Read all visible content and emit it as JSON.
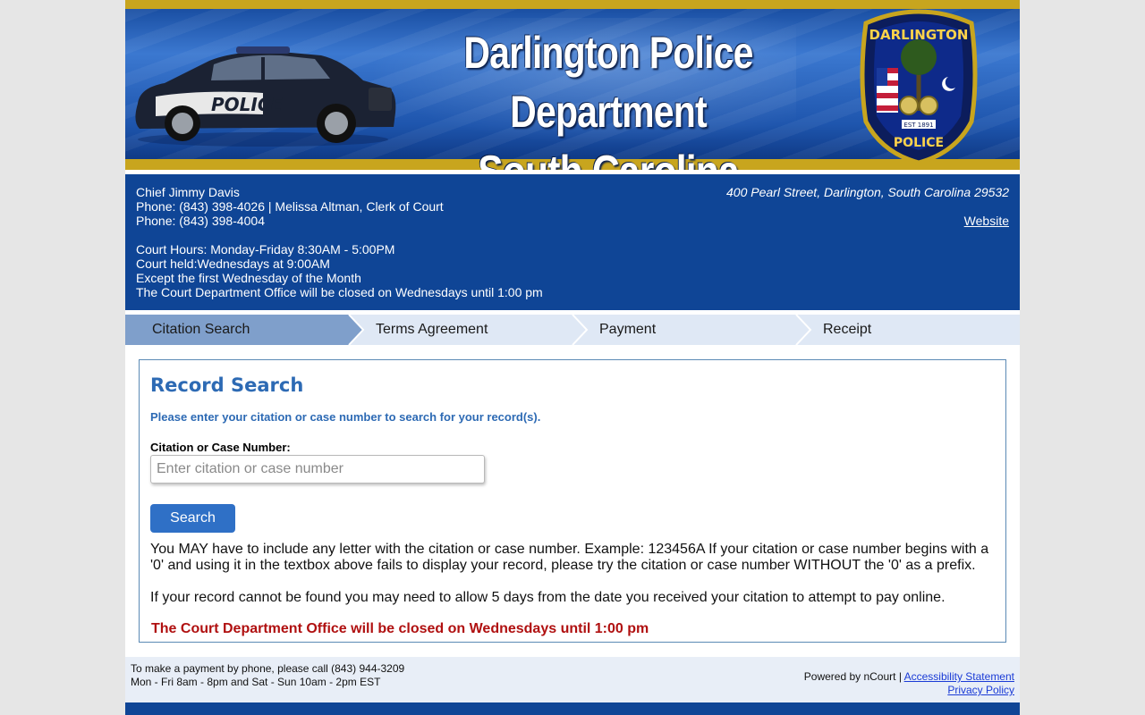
{
  "banner": {
    "title_line1": "Darlington Police Department",
    "title_line2": "South Carolina",
    "car_text": "POLICE",
    "badge_top": "DARLINGTON",
    "badge_bottom": "POLICE",
    "badge_est": "EST 1891"
  },
  "info": {
    "chief": "Chief Jimmy Davis",
    "phone1": "Phone: (843) 398-4026 | Melissa Altman, Clerk of Court",
    "phone2": "Phone: (843) 398-4004",
    "hours": "Court Hours: Monday-Friday 8:30AM - 5:00PM",
    "held": "Court held:Wednesdays at 9:00AM",
    "except": "Except the first Wednesday of the Month",
    "closed": "The Court Department Office will be closed on Wednesdays until 1:00 pm",
    "address": "400 Pearl Street, Darlington, South Carolina 29532",
    "website": "Website"
  },
  "steps": [
    {
      "label": "Citation Search",
      "active": true
    },
    {
      "label": "Terms Agreement",
      "active": false
    },
    {
      "label": "Payment",
      "active": false
    },
    {
      "label": "Receipt",
      "active": false
    }
  ],
  "search": {
    "heading": "Record Search",
    "hint": "Please enter your citation or case number to search for your record(s).",
    "field_label": "Citation or Case Number:",
    "placeholder": "Enter citation or case number",
    "value": "",
    "button": "Search",
    "para1": "You MAY have to include any letter with the citation or case number. Example: 123456A If your citation or case number begins with a '0' and using it in the textbox above fails to display your record, please try the citation or case number WITHOUT the '0' as a prefix.",
    "para2": "If your record cannot be found you may need to allow 5 days from the date you received your citation to attempt to pay online.",
    "notice": "The Court Department Office will be closed on Wednesdays until 1:00 pm"
  },
  "footer": {
    "phone_line": "To make a payment by phone, please call (843) 944-3209",
    "hours_line": "Mon - Fri 8am - 8pm and Sat - Sun 10am - 2pm EST",
    "powered": "Powered by nCourt |",
    "accessibility": "Accessibility Statement",
    "privacy": "Privacy Policy"
  },
  "colors": {
    "brand_blue": "#0f4596",
    "gold": "#c8a51e",
    "accent_blue": "#2f70c6",
    "alert_red": "#b01010"
  }
}
